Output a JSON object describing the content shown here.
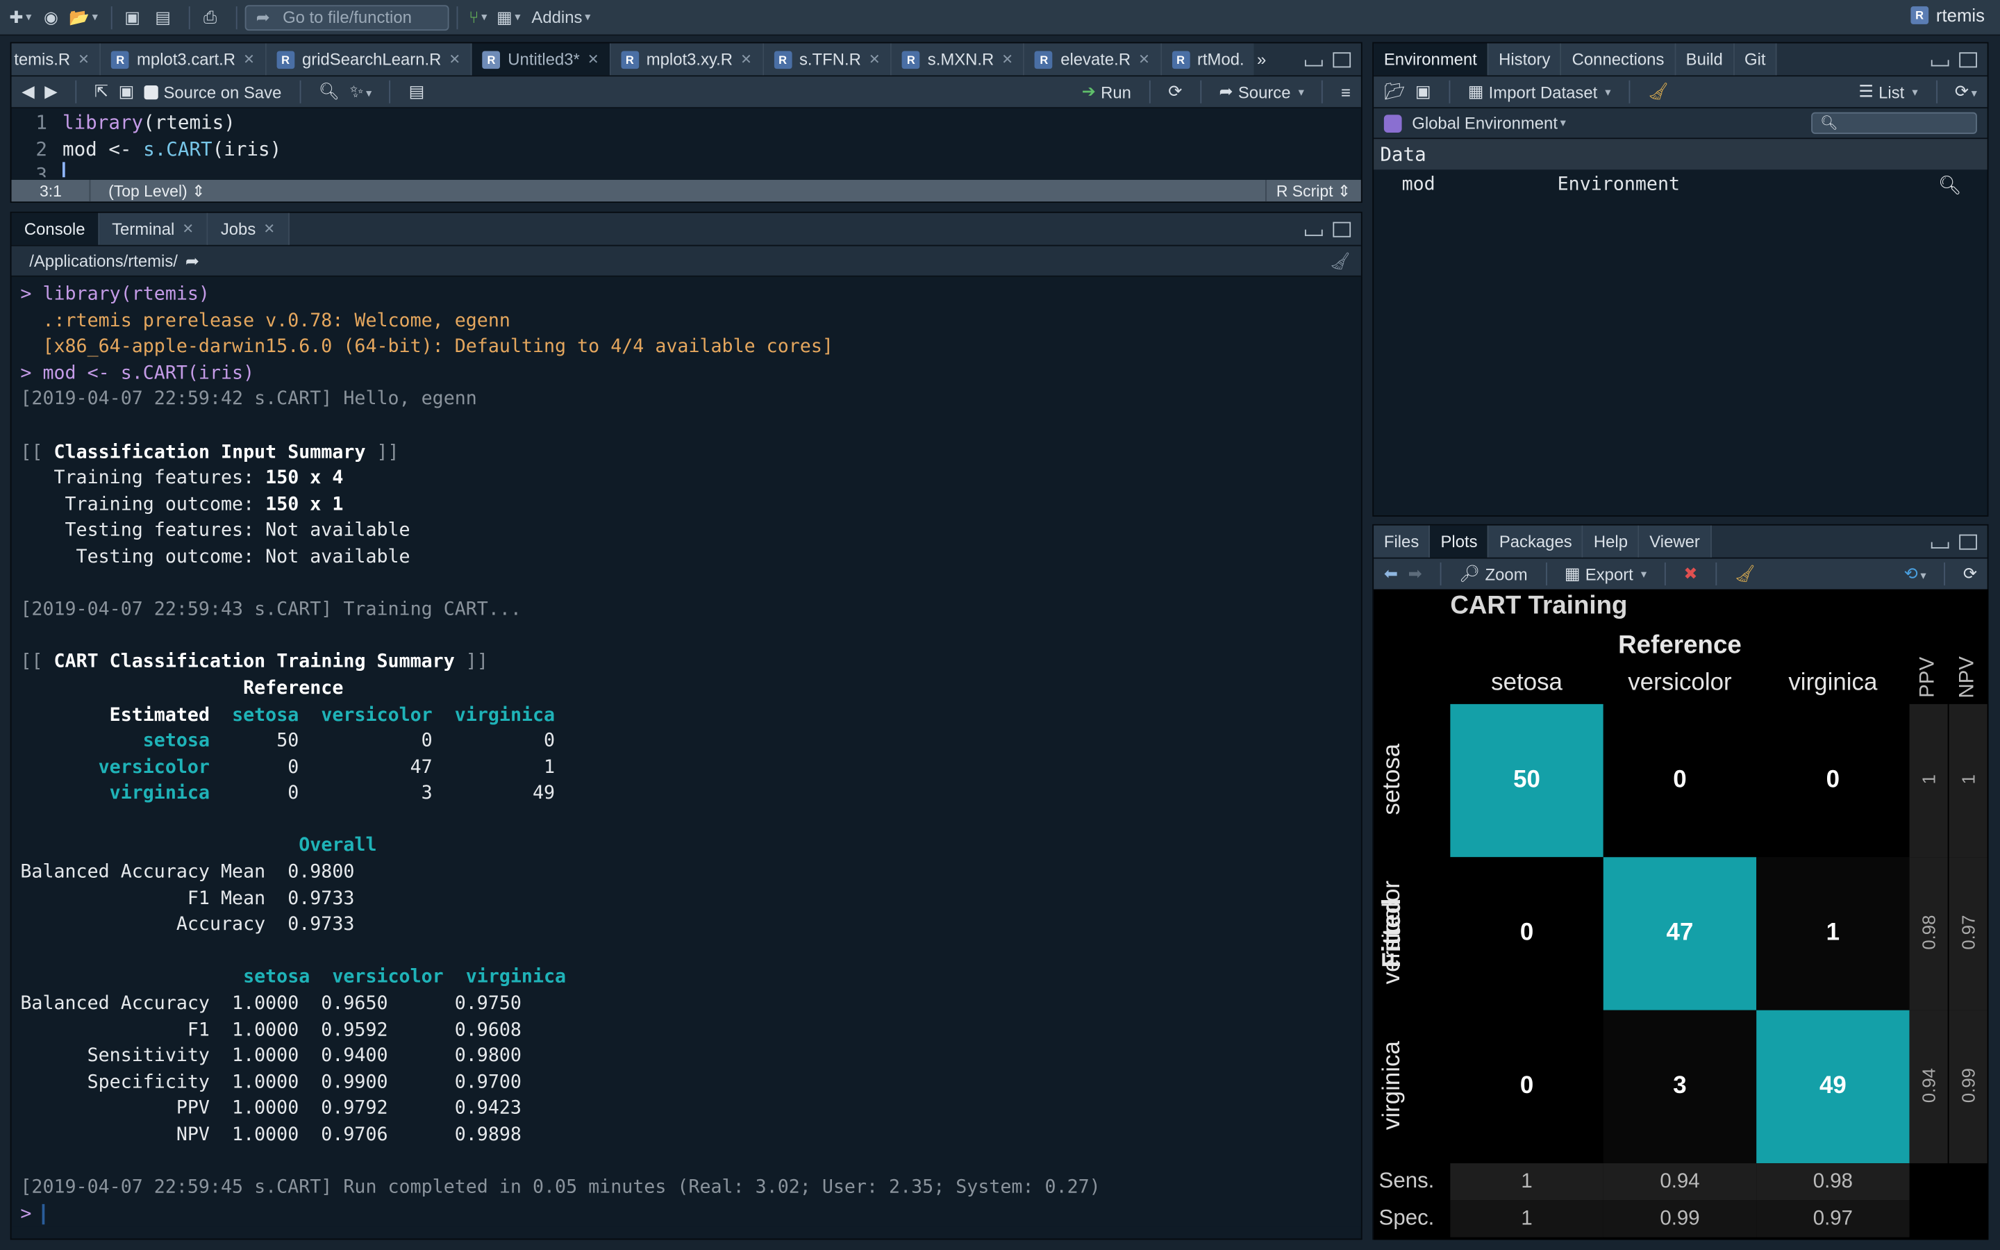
{
  "toolbar": {
    "goto_placeholder": "Go to file/function",
    "addins": "Addins",
    "user": "rtemis"
  },
  "editor": {
    "tabs": [
      "temis.R",
      "mplot3.cart.R",
      "gridSearchLearn.R",
      "Untitled3*",
      "mplot3.xy.R",
      "s.TFN.R",
      "s.MXN.R",
      "elevate.R",
      "rtMod."
    ],
    "active_tab": "Untitled3*",
    "source_on_save": "Source on Save",
    "run": "Run",
    "source": "Source",
    "lines": [
      {
        "n": "1",
        "text": "library(rtemis)"
      },
      {
        "n": "2",
        "text": "mod <- s.CART(iris)"
      },
      {
        "n": "3",
        "text": ""
      }
    ],
    "status_pos": "3:1",
    "status_scope": "(Top Level)",
    "status_type": "R Script"
  },
  "console": {
    "tabs": [
      "Console",
      "Terminal",
      "Jobs"
    ],
    "path": "/Applications/rtemis/",
    "lines": [
      "> library(rtemis)",
      "  .:rtemis prerelease v.0.78: Welcome, egenn",
      "  [x86_64-apple-darwin15.6.0 (64-bit): Defaulting to 4/4 available cores]",
      "> mod <- s.CART(iris)",
      "[2019-04-07 22:59:42 s.CART] Hello, egenn",
      "",
      "[[ Classification Input Summary ]]",
      "   Training features: 150 x 4",
      "    Training outcome: 150 x 1",
      "    Testing features: Not available",
      "     Testing outcome: Not available",
      "",
      "[2019-04-07 22:59:43 s.CART] Training CART...",
      "",
      "[[ CART Classification Training Summary ]]",
      "                    Reference",
      "        Estimated  setosa  versicolor  virginica",
      "           setosa      50           0          0",
      "       versicolor       0          47          1",
      "        virginica       0           3         49",
      "",
      "                         Overall",
      "Balanced Accuracy Mean  0.9800",
      "               F1 Mean  0.9733",
      "              Accuracy  0.9733",
      "",
      "                    setosa  versicolor  virginica",
      "Balanced Accuracy  1.0000  0.9650      0.9750",
      "               F1  1.0000  0.9592      0.9608",
      "      Sensitivity  1.0000  0.9400      0.9800",
      "      Specificity  1.0000  0.9900      0.9700",
      "              PPV  1.0000  0.9792      0.9423",
      "              NPV  1.0000  0.9706      0.9898",
      "",
      "[2019-04-07 22:59:45 s.CART] Run completed in 0.05 minutes (Real: 3.02; User: 2.35; System: 0.27)",
      "> "
    ]
  },
  "environment": {
    "tabs": [
      "Environment",
      "History",
      "Connections",
      "Build",
      "Git"
    ],
    "import_dataset": "Import Dataset",
    "list_view": "List",
    "scope": "Global Environment",
    "section": "Data",
    "rows": [
      {
        "name": "mod",
        "value": "Environment"
      }
    ]
  },
  "files_pane": {
    "tabs": [
      "Files",
      "Plots",
      "Packages",
      "Help",
      "Viewer"
    ],
    "zoom": "Zoom",
    "export": "Export"
  },
  "chart_data": {
    "type": "heatmap",
    "title": "CART Training",
    "xlabel": "Reference",
    "ylabel": "Fitted",
    "categories": [
      "setosa",
      "versicolor",
      "virginica"
    ],
    "matrix": [
      [
        50,
        0,
        0
      ],
      [
        0,
        47,
        1
      ],
      [
        0,
        3,
        49
      ]
    ],
    "ppv": [
      "1",
      "0.98",
      "0.94"
    ],
    "npv": [
      "1",
      "0.97",
      "0.99"
    ],
    "ppv_label": "PPV",
    "npv_label": "NPV",
    "sens": [
      "1",
      "0.94",
      "0.98"
    ],
    "spec": [
      "1",
      "0.99",
      "0.97"
    ],
    "sens_label": "Sens.",
    "spec_label": "Spec.",
    "colors": {
      "high": "#14a0a8",
      "low": "#000000",
      "side": "#1e1e1e"
    }
  }
}
